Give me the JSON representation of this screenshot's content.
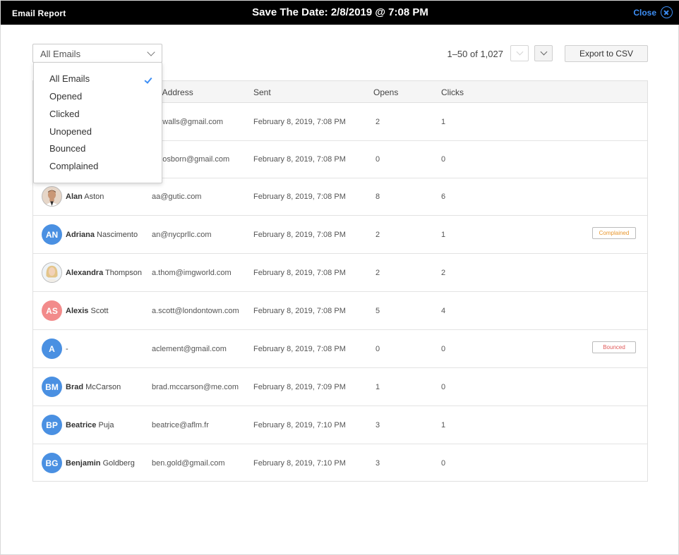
{
  "titlebar": {
    "report_label": "Email Report",
    "title": "Save The Date: 2/8/2019 @ 7:08 PM",
    "close_label": "Close"
  },
  "filter": {
    "selected": "All Emails",
    "options": [
      "All Emails",
      "Opened",
      "Clicked",
      "Unopened",
      "Bounced",
      "Complained"
    ]
  },
  "pager": {
    "range_text": "1–50 of 1,027"
  },
  "export_label": "Export to CSV",
  "columns": {
    "email": "ail Address",
    "sent": "Sent",
    "opens": "Opens",
    "clicks": "Clicks"
  },
  "rows": [
    {
      "first": "",
      "last": "",
      "email": "on.walls@gmail.com",
      "sent": "February 8, 2019, 7:08 PM",
      "opens": "2",
      "clicks": "1",
      "badge": ""
    },
    {
      "first": "",
      "last": "",
      "email": "on.osborn@gmail.com",
      "sent": "February 8, 2019, 7:08 PM",
      "opens": "0",
      "clicks": "0",
      "badge": ""
    },
    {
      "first": "Alan",
      "last": " Aston",
      "email": "aa@gutic.com",
      "sent": "February 8, 2019, 7:08 PM",
      "opens": "8",
      "clicks": "6",
      "badge": "",
      "avatar_icon": "man-photo-icon"
    },
    {
      "first": "Adriana",
      "last": " Nascimento",
      "email": "an@nycprllc.com",
      "sent": "February 8, 2019, 7:08 PM",
      "opens": "2",
      "clicks": "1",
      "badge": "Complained",
      "initials": "AN",
      "avatar_color": "#4a90e2"
    },
    {
      "first": "Alexandra",
      "last": " Thompson",
      "email": "a.thom@imgworld.com",
      "sent": "February 8, 2019, 7:08 PM",
      "opens": "2",
      "clicks": "2",
      "badge": "",
      "avatar_icon": "woman-photo-icon"
    },
    {
      "first": "Alexis",
      "last": " Scott",
      "email": "a.scott@londontown.com",
      "sent": "February 8, 2019, 7:08 PM",
      "opens": "5",
      "clicks": "4",
      "badge": "",
      "initials": "AS",
      "avatar_color": "#f28b8b"
    },
    {
      "first": "",
      "last": "-",
      "email": "aclement@gmail.com",
      "sent": "February 8, 2019, 7:08 PM",
      "opens": "0",
      "clicks": "0",
      "badge": "Bounced",
      "initials": "A",
      "avatar_color": "#4a90e2"
    },
    {
      "first": "Brad",
      "last": " McCarson",
      "email": "brad.mccarson@me.com",
      "sent": "February 8, 2019, 7:09 PM",
      "opens": "1",
      "clicks": "0",
      "badge": "",
      "initials": "BM",
      "avatar_color": "#4a90e2"
    },
    {
      "first": "Beatrice",
      "last": " Puja",
      "email": "beatrice@aflm.fr",
      "sent": "February 8, 2019, 7:10 PM",
      "opens": "3",
      "clicks": "1",
      "badge": "",
      "initials": "BP",
      "avatar_color": "#4a90e2"
    },
    {
      "first": "Benjamin",
      "last": " Goldberg",
      "email": "ben.gold@gmail.com",
      "sent": "February 8, 2019, 7:10 PM",
      "opens": "3",
      "clicks": "0",
      "badge": "",
      "initials": "BG",
      "avatar_color": "#4a90e2"
    }
  ],
  "colors": {
    "accent": "#3d8ef5",
    "complained": "#e8962c",
    "bounced": "#e05a5a"
  }
}
